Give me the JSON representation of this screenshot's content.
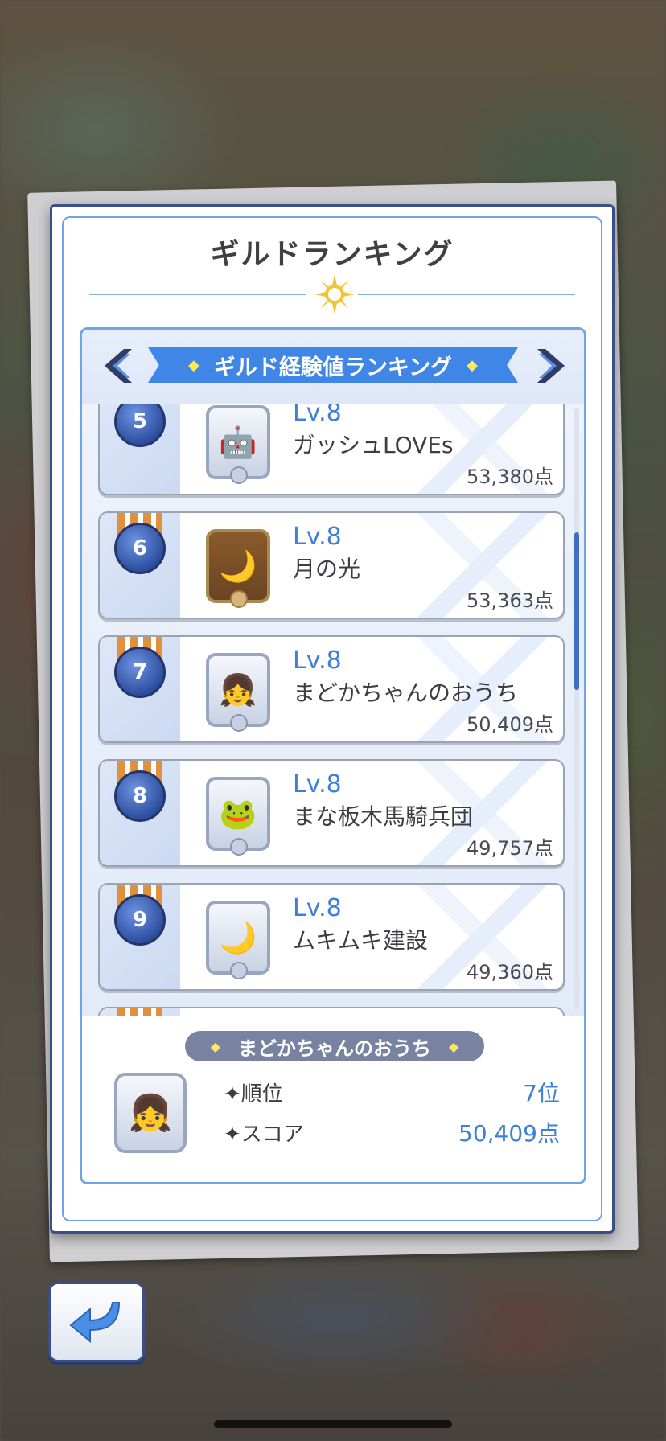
{
  "dialog": {
    "title": "ギルドランキング"
  },
  "panel": {
    "banner_label": "ギルド経験値ランキング"
  },
  "rows": [
    {
      "rank": "5",
      "level": "Lv.8",
      "name": "ガッシュLOVEs",
      "score": "53,380点",
      "emblem_icon": "robot-emblem-icon"
    },
    {
      "rank": "6",
      "level": "Lv.8",
      "name": "月の光",
      "score": "53,363点",
      "emblem_icon": "moon-emblem-icon"
    },
    {
      "rank": "7",
      "level": "Lv.8",
      "name": "まどかちゃんのおうち",
      "score": "50,409点",
      "emblem_icon": "girl-emblem-icon"
    },
    {
      "rank": "8",
      "level": "Lv.8",
      "name": "まな板木馬騎兵団",
      "score": "49,757点",
      "emblem_icon": "frog-emblem-icon"
    },
    {
      "rank": "9",
      "level": "Lv.8",
      "name": "ムキムキ建設",
      "score": "49,360点",
      "emblem_icon": "moon-emblem-icon"
    }
  ],
  "own_guild": {
    "name": "まどかちゃんのおうち",
    "rank_label": "✦順位",
    "rank_value": "7位",
    "score_label": "✦スコア",
    "score_value": "50,409点"
  },
  "colors": {
    "accent": "#3f86e6",
    "frame": "#3b4f86",
    "level_text": "#3f7fd8"
  }
}
